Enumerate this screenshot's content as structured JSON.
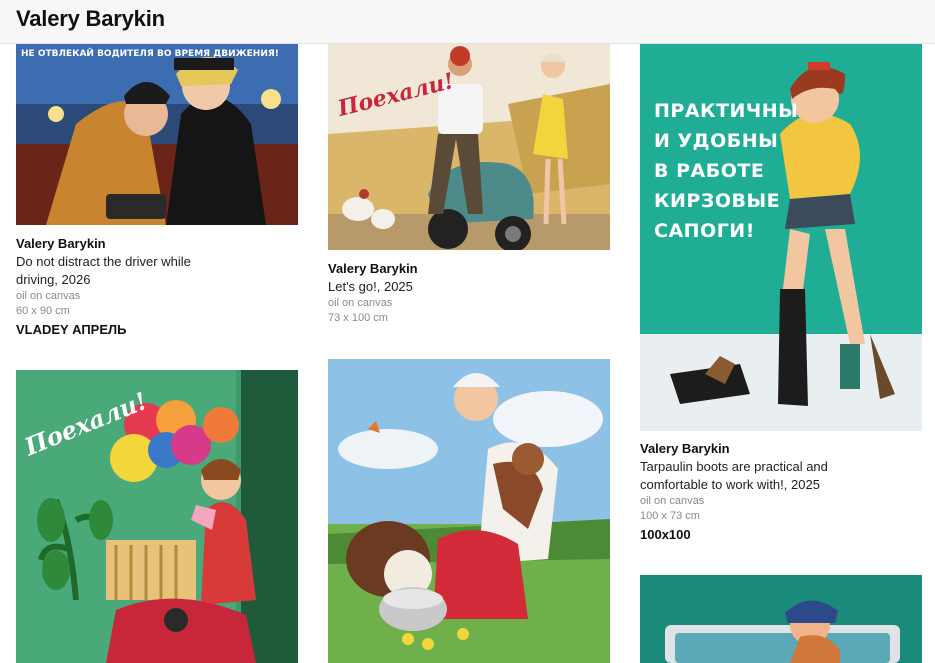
{
  "header": {
    "title": "Valery Barykin"
  },
  "artworks": [
    {
      "artist": "Valery Barykin",
      "title": "Do not distract the driver while driving, 2026",
      "medium": "oil on canvas",
      "size": "60 x 90 cm",
      "gallery": "VLADEY АПРЕЛЬ",
      "poster_text": "НЕ ОТВЛЕКАЙ ВОДИТЕЛЯ ВО ВРЕМЯ ДВИЖЕНИЯ!"
    },
    {
      "artist": "Valery Barykin",
      "title": "Let's go!, 2025",
      "medium": "oil on canvas",
      "size": "73 x 100 cm",
      "poster_text": "Поехали!"
    },
    {
      "artist": "Valery Barykin",
      "title": "Tarpaulin boots are practical and comfortable to work with!, 2025",
      "medium": "oil on canvas",
      "size": "100 x 73 cm",
      "gallery": "100x100",
      "poster_lines": [
        "ПРАКТИЧНЫ",
        "И УДОБНЫ",
        "В РАБОТЕ",
        "КИРЗОВЫЕ",
        "САПОГИ!"
      ]
    },
    {
      "poster_text": "Поехали!"
    },
    {},
    {}
  ],
  "colors": {
    "header_bg": "#f7f7f7",
    "text": "#111111",
    "muted": "#8a8a8a",
    "poster_green": "#1a9e86",
    "poster_red": "#c8263a"
  }
}
